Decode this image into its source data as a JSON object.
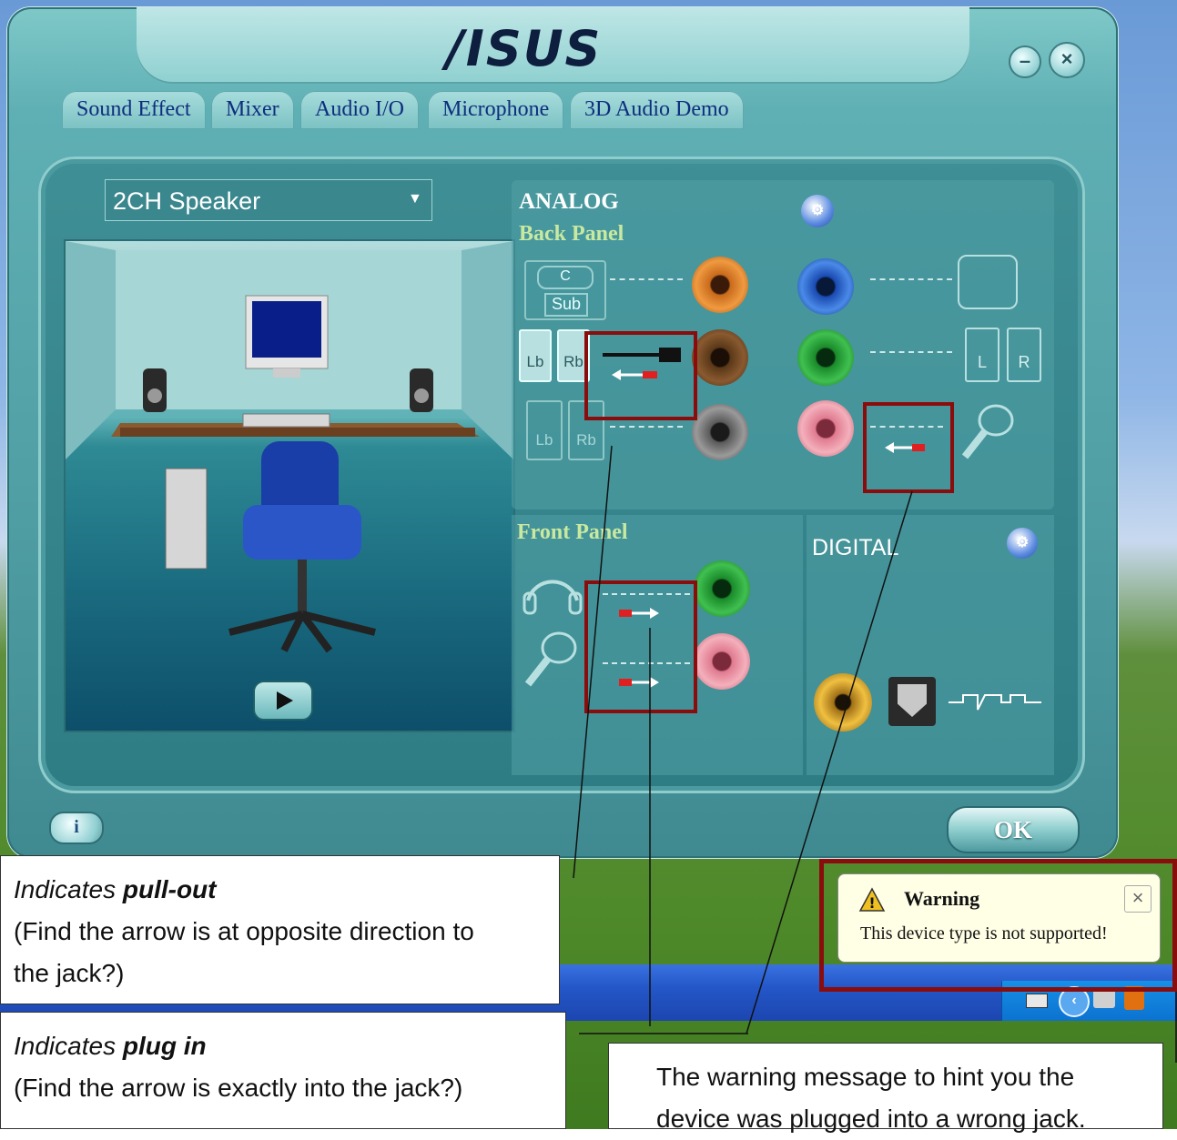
{
  "window": {
    "brand": "/ISUS",
    "minimize_label": "–",
    "close_label": "×"
  },
  "tabs": [
    "Sound Effect",
    "Mixer",
    "Audio I/O",
    "Microphone",
    "3D Audio Demo"
  ],
  "speaker_config": {
    "selected": "2CH Speaker"
  },
  "analog": {
    "title": "ANALOG",
    "back_panel_label": "Back Panel",
    "front_panel_label": "Front Panel",
    "center_label": "C",
    "sub_label": "Sub",
    "lb_label": "Lb",
    "rb_label": "Rb",
    "left_label": "L",
    "right_label": "R"
  },
  "digital": {
    "title": "DIGITAL"
  },
  "buttons": {
    "ok": "OK",
    "info": "i"
  },
  "notification": {
    "title": "Warning",
    "message": "This device type is not supported!",
    "close": "×"
  },
  "callouts": {
    "pullout_prefix": "Indicates ",
    "pullout_bold": "pull-out",
    "pullout_hint": "(Find the arrow is at opposite direction to",
    "pullout_hint2": "the jack?)",
    "plugin_prefix": "Indicates ",
    "plugin_bold": "plug in",
    "plugin_hint": "(Find the arrow is exactly into the jack?)",
    "warning_line1": "The warning message to hint you the",
    "warning_line2": "device was plugged into a wrong jack."
  },
  "colors": {
    "window_teal": "#4f9ea4",
    "highlight_red": "#8a0c0c",
    "jack_orange": "#c86a1c",
    "jack_blue": "#1a4ab0",
    "jack_green": "#1a8a2a",
    "jack_pink": "#e07a90"
  }
}
